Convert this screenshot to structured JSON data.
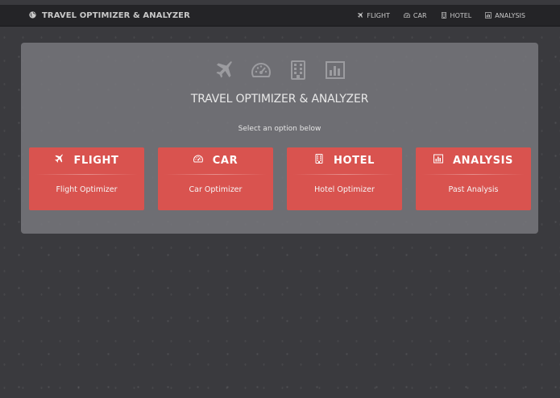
{
  "navbar": {
    "brand_icon": "globe-icon",
    "brand": "TRAVEL OPTIMIZER & ANALYZER",
    "links": [
      {
        "label": "FLIGHT",
        "icon": "plane-icon"
      },
      {
        "label": "CAR",
        "icon": "dashboard-icon"
      },
      {
        "label": "HOTEL",
        "icon": "building-icon"
      },
      {
        "label": "ANALYSIS",
        "icon": "bar-chart-icon"
      }
    ]
  },
  "hero": {
    "icons": [
      "plane-icon",
      "dashboard-icon",
      "building-icon",
      "bar-chart-icon"
    ],
    "title": "TRAVEL OPTIMIZER & ANALYZER",
    "subtitle": "Select an option below"
  },
  "cards": [
    {
      "title": "FLIGHT",
      "subtitle": "Flight Optimizer",
      "icon": "plane-icon"
    },
    {
      "title": "CAR",
      "subtitle": "Car Optimizer",
      "icon": "dashboard-icon"
    },
    {
      "title": "HOTEL",
      "subtitle": "Hotel Optimizer",
      "icon": "building-icon"
    },
    {
      "title": "ANALYSIS",
      "subtitle": "Past Analysis",
      "icon": "bar-chart-icon"
    }
  ],
  "colors": {
    "background": "#3a3a3e",
    "navbar": "#242427",
    "panel": "#78787c",
    "card": "#d9534f"
  }
}
